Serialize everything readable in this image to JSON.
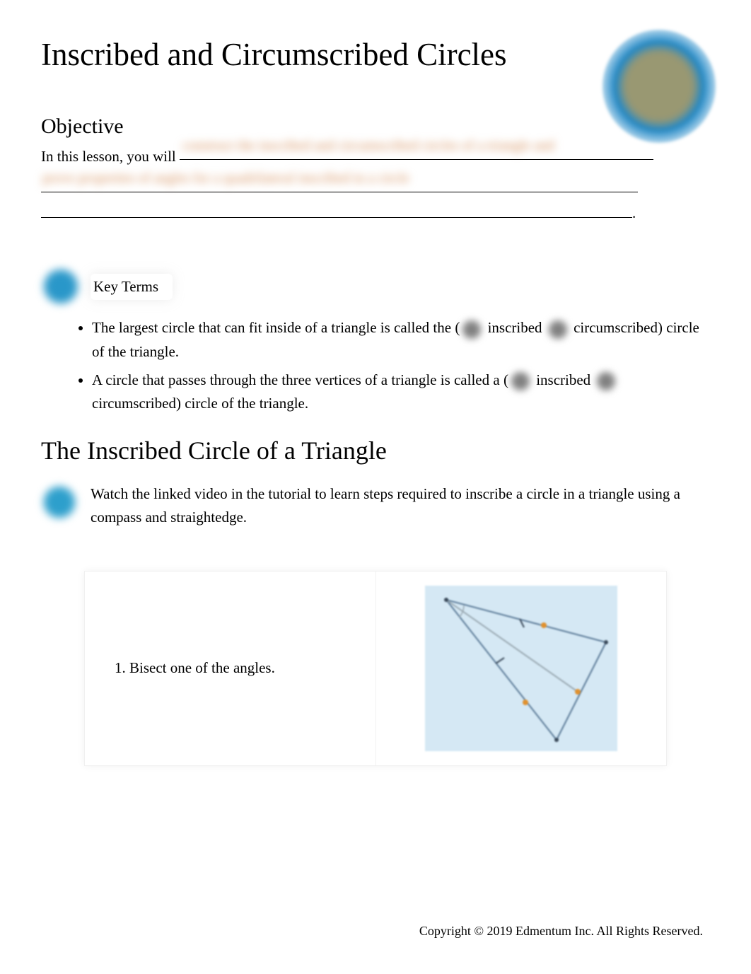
{
  "header": {
    "title": "Inscribed and Circumscribed Circles"
  },
  "objective": {
    "heading": "Objective",
    "intro": "In this lesson, you will ",
    "blur_line_1": "construct the inscribed and circumscribed circles of a triangle and",
    "blur_line_2": "prove properties of angles for a quadrilateral inscribed in a circle",
    "trailing_period": "."
  },
  "key_terms": {
    "label": "Key Terms",
    "items": [
      {
        "pre": "The largest circle that can fit inside of a triangle is called the (",
        "opt1": " inscribed ",
        "opt2": " circumscribed) circle of the triangle."
      },
      {
        "pre": "A circle that passes through the three vertices of a triangle is called a (",
        "opt1": " inscribed ",
        "opt2": " circumscribed) circle of the triangle."
      }
    ]
  },
  "section": {
    "heading": "The Inscribed Circle of a Triangle",
    "video_text": "Watch the linked video in the tutorial to learn steps required to inscribe a circle in a triangle using a compass and straightedge."
  },
  "steps": [
    {
      "text": "Bisect one of the angles."
    }
  ],
  "footer": {
    "copyright": "Copyright © 2019 Edmentum Inc. All Rights Reserved."
  }
}
